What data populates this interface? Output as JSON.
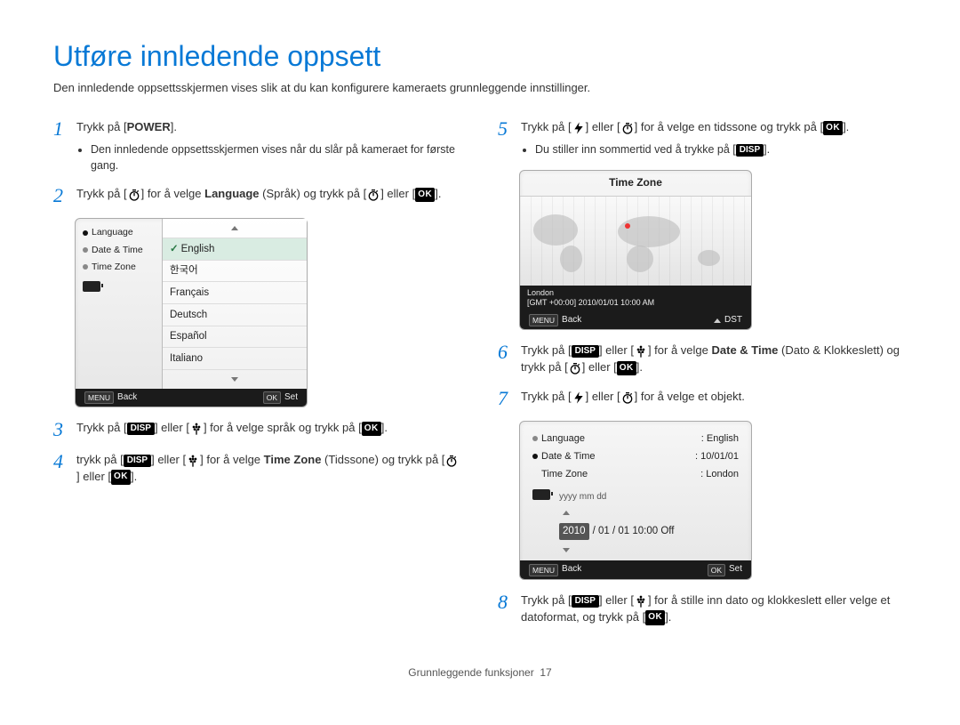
{
  "title": "Utføre innledende oppsett",
  "intro": "Den innledende oppsettsskjermen vises slik at du kan konfigurere kameraets grunnleggende innstillinger.",
  "icons": {
    "power": "POWER",
    "disp": "DISP",
    "ok": "OK",
    "menu": "MENU"
  },
  "steps": {
    "s1_a": "Trykk på [",
    "s1_b": "].",
    "s1_bullet": "Den innledende oppsettsskjermen vises når du slår på kameraet for første gang.",
    "s2_a": "Trykk på [",
    "s2_b": "] for å velge ",
    "s2_lang": "Language",
    "s2_c": " (Språk) og trykk på [",
    "s2_d": "] eller [",
    "s2_e": "].",
    "s3_a": "Trykk på [",
    "s3_b": "] eller [",
    "s3_c": "] for å velge språk og trykk på [",
    "s3_d": "].",
    "s4_a": "trykk på [",
    "s4_b": "] eller [",
    "s4_c": "] for å velge ",
    "s4_tz": "Time Zone",
    "s4_d": " (Tidssone) og trykk på [",
    "s4_e": "] eller [",
    "s4_f": "].",
    "s5_a": "Trykk på [",
    "s5_b": "] eller [",
    "s5_c": "] for å velge en tidssone og trykk på [",
    "s5_d": "].",
    "s5_bullet_a": "Du stiller inn sommertid ved å trykke på [",
    "s5_bullet_b": "].",
    "s6_a": "Trykk på [",
    "s6_b": "] eller [",
    "s6_c": "] for å velge ",
    "s6_dt": "Date & Time",
    "s6_d": " (Dato & Klokkeslett) og trykk på [",
    "s6_e": "] eller [",
    "s6_f": "].",
    "s7_a": "Trykk på [",
    "s7_b": "] eller [",
    "s7_c": "] for å velge et objekt.",
    "s8_a": "Trykk på [",
    "s8_b": "] eller [",
    "s8_c": "] for å stille inn dato og klokkeslett eller velge et datoformat, og trykk på [",
    "s8_d": "]."
  },
  "step_nums": {
    "n1": "1",
    "n2": "2",
    "n3": "3",
    "n4": "4",
    "n5": "5",
    "n6": "6",
    "n7": "7",
    "n8": "8"
  },
  "lang_ui": {
    "side": {
      "language": "Language",
      "datetime": "Date & Time",
      "timezone": "Time Zone"
    },
    "langs": [
      "English",
      "한국어",
      "Français",
      "Deutsch",
      "Español",
      "Italiano"
    ],
    "footer_back": "Back",
    "footer_set": "Set"
  },
  "tz_ui": {
    "title": "Time Zone",
    "city": "London",
    "gmt": "[GMT +00:00] 2010/01/01 10:00 AM",
    "footer_back": "Back",
    "footer_dst": "DST"
  },
  "dt_ui": {
    "rows": {
      "language_label": "Language",
      "language_value": "English",
      "datetime_label": "Date & Time",
      "datetime_value": "10/01/01",
      "timezone_label": "Time Zone",
      "timezone_value": "London"
    },
    "date_labels": "yyyy   mm   dd",
    "date_year": "2010",
    "date_rest": " / 01 / 01   10:00    Off",
    "footer_back": "Back",
    "footer_set": "Set"
  },
  "page_footer": {
    "section": "Grunnleggende funksjoner",
    "num": "17"
  }
}
